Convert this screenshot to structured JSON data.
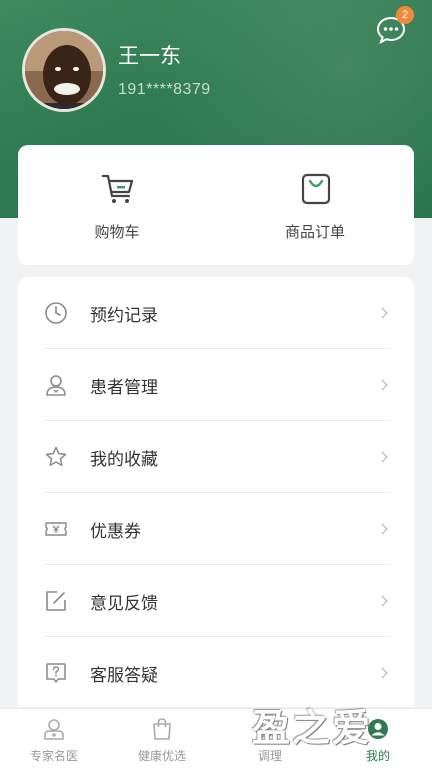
{
  "profile": {
    "name": "王一东",
    "phone": "191****8379",
    "message_badge": "2"
  },
  "quick": [
    {
      "label": "购物车",
      "icon": "cart-icon"
    },
    {
      "label": "商品订单",
      "icon": "bag-icon"
    }
  ],
  "menu": [
    {
      "label": "预约记录",
      "icon": "clock-icon"
    },
    {
      "label": "患者管理",
      "icon": "person-icon"
    },
    {
      "label": "我的收藏",
      "icon": "star-icon"
    },
    {
      "label": "优惠券",
      "icon": "coupon-icon"
    },
    {
      "label": "意见反馈",
      "icon": "edit-icon"
    },
    {
      "label": "客服答疑",
      "icon": "question-icon"
    }
  ],
  "tabs": [
    {
      "label": "专家名医",
      "icon": "doctor-icon"
    },
    {
      "label": "健康优选",
      "icon": "bag-icon"
    },
    {
      "label": "调理",
      "icon": "leaf-icon"
    },
    {
      "label": "我的",
      "icon": "user-icon",
      "active": true
    }
  ],
  "watermark": "盈之爱",
  "colors": {
    "brand_green": "#2f7a50",
    "badge_orange": "#f08a3a",
    "icon_gray": "#8a8a8a"
  }
}
